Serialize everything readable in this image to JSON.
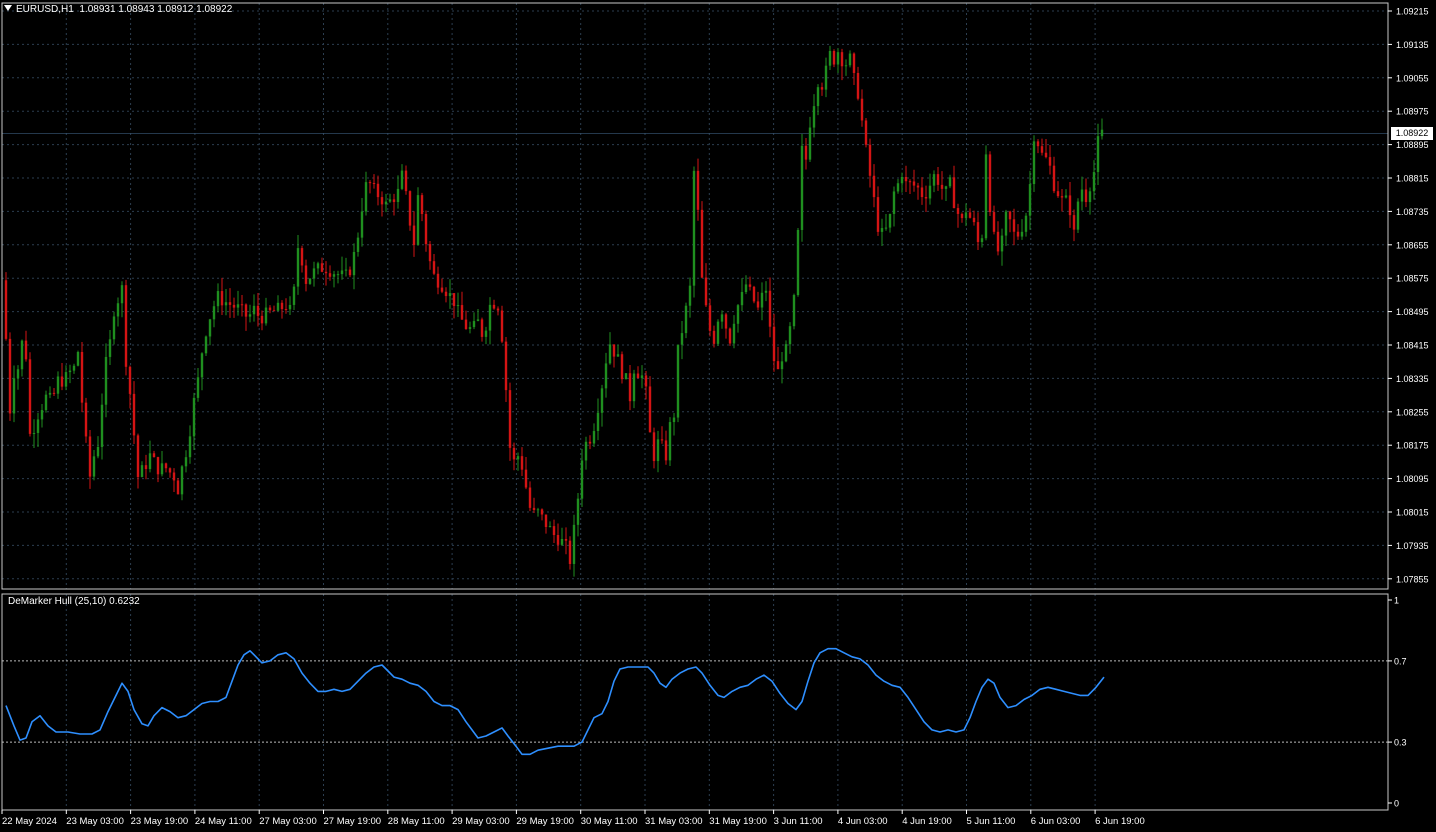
{
  "title": {
    "symbol": "EURUSD,H1",
    "ohlc": "1.08931 1.08943 1.08912 1.08922"
  },
  "price_axis": {
    "labels": [
      "1.09215",
      "1.09135",
      "1.09055",
      "1.08975",
      "1.08895",
      "1.08815",
      "1.08735",
      "1.08655",
      "1.08575",
      "1.08495",
      "1.08415",
      "1.08335",
      "1.08255",
      "1.08175",
      "1.08095",
      "1.08015",
      "1.07935",
      "1.07855"
    ],
    "current_price": "1.08922"
  },
  "indicator": {
    "title": "DeMarker Hull (25,10) 0.6232",
    "axis_labels": [
      "1",
      "0.7",
      "0.3",
      "0"
    ],
    "levels": [
      0.7,
      0.3
    ],
    "color": "#2e8fff"
  },
  "time_axis": {
    "labels": [
      "22 May 2024",
      "23 May 03:00",
      "23 May 19:00",
      "24 May 11:00",
      "27 May 03:00",
      "27 May 19:00",
      "28 May 11:00",
      "29 May 03:00",
      "29 May 19:00",
      "30 May 11:00",
      "31 May 03:00",
      "31 May 19:00",
      "3 Jun 11:00",
      "4 Jun 03:00",
      "4 Jun 19:00",
      "5 Jun 11:00",
      "6 Jun 03:00",
      "6 Jun 19:00"
    ]
  },
  "colors": {
    "background": "#000000",
    "bull": "#1f8f1f",
    "bear": "#d41414",
    "grid": "#2c3e50",
    "text": "#ffffff"
  },
  "chart_data": {
    "type": "candlestick",
    "symbol": "EURUSD",
    "timeframe": "H1",
    "y_range": [
      1.07855,
      1.09215
    ],
    "close_path": [
      [
        0,
        1.0857
      ],
      [
        4,
        1.0843
      ],
      [
        8,
        1.0826
      ],
      [
        12,
        1.0835
      ],
      [
        16,
        1.0836
      ],
      [
        20,
        1.0842
      ],
      [
        24,
        1.0839
      ],
      [
        28,
        1.082
      ],
      [
        32,
        1.0822
      ],
      [
        36,
        1.0825
      ],
      [
        44,
        1.0829
      ],
      [
        50,
        1.0828
      ],
      [
        56,
        1.0833
      ],
      [
        62,
        1.0833
      ],
      [
        68,
        1.0835
      ],
      [
        72,
        1.0836
      ],
      [
        76,
        1.084
      ],
      [
        80,
        1.0828
      ],
      [
        84,
        1.0818
      ],
      [
        88,
        1.081
      ],
      [
        92,
        1.0815
      ],
      [
        96,
        1.0818
      ],
      [
        100,
        1.0828
      ],
      [
        104,
        1.0837
      ],
      [
        108,
        1.0842
      ],
      [
        112,
        1.085
      ],
      [
        120,
        1.0855
      ],
      [
        124,
        1.0838
      ],
      [
        128,
        1.083
      ],
      [
        132,
        1.082
      ],
      [
        136,
        1.081
      ],
      [
        142,
        1.0812
      ],
      [
        148,
        1.0815
      ],
      [
        156,
        1.0812
      ],
      [
        164,
        1.0812
      ],
      [
        172,
        1.081
      ],
      [
        176,
        1.0807
      ],
      [
        180,
        1.0812
      ],
      [
        186,
        1.0818
      ],
      [
        192,
        1.0828
      ],
      [
        196,
        1.0833
      ],
      [
        200,
        1.084
      ],
      [
        204,
        1.0845
      ],
      [
        210,
        1.085
      ],
      [
        216,
        1.0853
      ],
      [
        222,
        1.0852
      ],
      [
        230,
        1.0851
      ],
      [
        238,
        1.085
      ],
      [
        246,
        1.0848
      ],
      [
        252,
        1.085
      ],
      [
        258,
        1.0848
      ],
      [
        266,
        1.0849
      ],
      [
        276,
        1.085
      ],
      [
        284,
        1.0851
      ],
      [
        290,
        1.0849
      ],
      [
        296,
        1.0865
      ],
      [
        300,
        1.0862
      ],
      [
        304,
        1.0857
      ],
      [
        308,
        1.0858
      ],
      [
        312,
        1.0859
      ],
      [
        318,
        1.086
      ],
      [
        324,
        1.086
      ],
      [
        332,
        1.0859
      ],
      [
        340,
        1.0858
      ],
      [
        346,
        1.0858
      ],
      [
        352,
        1.0863
      ],
      [
        356,
        1.0868
      ],
      [
        362,
        1.0878
      ],
      [
        366,
        1.0881
      ],
      [
        370,
        1.0879
      ],
      [
        374,
        1.0878
      ],
      [
        378,
        1.0877
      ],
      [
        382,
        1.0876
      ],
      [
        386,
        1.0874
      ],
      [
        390,
        1.0878
      ],
      [
        394,
        1.0876
      ],
      [
        400,
        1.0882
      ],
      [
        404,
        1.0877
      ],
      [
        408,
        1.0871
      ],
      [
        412,
        1.0866
      ],
      [
        416,
        1.0877
      ],
      [
        420,
        1.0873
      ],
      [
        426,
        1.0863
      ],
      [
        432,
        1.0858
      ],
      [
        440,
        1.0856
      ],
      [
        446,
        1.0854
      ],
      [
        452,
        1.0852
      ],
      [
        458,
        1.0848
      ],
      [
        464,
        1.0846
      ],
      [
        470,
        1.0845
      ],
      [
        476,
        1.0847
      ],
      [
        482,
        1.0843
      ],
      [
        486,
        1.085
      ],
      [
        490,
        1.0852
      ],
      [
        496,
        1.0851
      ],
      [
        502,
        1.084
      ],
      [
        506,
        1.0822
      ],
      [
        510,
        1.0812
      ],
      [
        514,
        1.0815
      ],
      [
        518,
        1.0815
      ],
      [
        522,
        1.081
      ],
      [
        526,
        1.0805
      ],
      [
        530,
        1.08
      ],
      [
        534,
        1.0802
      ],
      [
        540,
        1.08
      ],
      [
        546,
        1.0798
      ],
      [
        552,
        1.0796
      ],
      [
        558,
        1.0795
      ],
      [
        564,
        1.0793
      ],
      [
        568,
        1.079
      ],
      [
        572,
        1.0797
      ],
      [
        576,
        1.0805
      ],
      [
        580,
        1.0815
      ],
      [
        584,
        1.0818
      ],
      [
        590,
        1.082
      ],
      [
        596,
        1.0827
      ],
      [
        600,
        1.0832
      ],
      [
        604,
        1.0838
      ],
      [
        608,
        1.0842
      ],
      [
        612,
        1.084
      ],
      [
        616,
        1.0838
      ],
      [
        620,
        1.0835
      ],
      [
        624,
        1.0833
      ],
      [
        628,
        1.0829
      ],
      [
        632,
        1.0836
      ],
      [
        636,
        1.0835
      ],
      [
        640,
        1.0834
      ],
      [
        644,
        1.083
      ],
      [
        648,
        1.082
      ],
      [
        652,
        1.0815
      ],
      [
        656,
        1.0818
      ],
      [
        660,
        1.0817
      ],
      [
        664,
        1.0815
      ],
      [
        668,
        1.0822
      ],
      [
        672,
        1.0825
      ],
      [
        676,
        1.084
      ],
      [
        680,
        1.0845
      ],
      [
        684,
        1.085
      ],
      [
        688,
        1.0855
      ],
      [
        692,
        1.0883
      ],
      [
        696,
        1.0873
      ],
      [
        700,
        1.0857
      ],
      [
        704,
        1.085
      ],
      [
        708,
        1.0845
      ],
      [
        712,
        1.0843
      ],
      [
        716,
        1.0848
      ],
      [
        720,
        1.085
      ],
      [
        724,
        1.0846
      ],
      [
        728,
        1.0843
      ],
      [
        732,
        1.0848
      ],
      [
        736,
        1.0851
      ],
      [
        740,
        1.0853
      ],
      [
        744,
        1.0856
      ],
      [
        748,
        1.0854
      ],
      [
        752,
        1.0852
      ],
      [
        756,
        1.085
      ],
      [
        760,
        1.0853
      ],
      [
        764,
        1.0855
      ],
      [
        768,
        1.0845
      ],
      [
        772,
        1.0838
      ],
      [
        776,
        1.0835
      ],
      [
        780,
        1.0839
      ],
      [
        784,
        1.084
      ],
      [
        788,
        1.0845
      ],
      [
        792,
        1.0852
      ],
      [
        796,
        1.0868
      ],
      [
        800,
        1.0888
      ],
      [
        804,
        1.0886
      ],
      [
        808,
        1.0895
      ],
      [
        812,
        1.09
      ],
      [
        816,
        1.0905
      ],
      [
        820,
        1.0904
      ],
      [
        824,
        1.0907
      ],
      [
        828,
        1.0911
      ],
      [
        832,
        1.091
      ],
      [
        836,
        1.0912
      ],
      [
        840,
        1.091
      ],
      [
        844,
        1.0909
      ],
      [
        848,
        1.091
      ],
      [
        852,
        1.0905
      ],
      [
        856,
        1.0902
      ],
      [
        860,
        1.0895
      ],
      [
        864,
        1.0888
      ],
      [
        868,
        1.0882
      ],
      [
        872,
        1.0876
      ],
      [
        876,
        1.087
      ],
      [
        880,
        1.0868
      ],
      [
        884,
        1.0869
      ],
      [
        888,
        1.0872
      ],
      [
        892,
        1.0878
      ],
      [
        896,
        1.088
      ],
      [
        900,
        1.0883
      ],
      [
        904,
        1.088
      ],
      [
        910,
        1.088
      ],
      [
        916,
        1.0879
      ],
      [
        922,
        1.0877
      ],
      [
        928,
        1.088
      ],
      [
        932,
        1.0882
      ],
      [
        936,
        1.0881
      ],
      [
        940,
        1.0879
      ],
      [
        944,
        1.0878
      ],
      [
        948,
        1.088
      ],
      [
        952,
        1.0876
      ],
      [
        956,
        1.0873
      ],
      [
        960,
        1.0871
      ],
      [
        964,
        1.0874
      ],
      [
        968,
        1.0872
      ],
      [
        972,
        1.087
      ],
      [
        976,
        1.0866
      ],
      [
        980,
        1.0868
      ],
      [
        984,
        1.0888
      ],
      [
        988,
        1.0875
      ],
      [
        992,
        1.0867
      ],
      [
        996,
        1.0864
      ],
      [
        1000,
        1.0866
      ],
      [
        1004,
        1.0872
      ],
      [
        1008,
        1.0871
      ],
      [
        1012,
        1.0868
      ],
      [
        1016,
        1.0868
      ],
      [
        1020,
        1.087
      ],
      [
        1024,
        1.0873
      ],
      [
        1028,
        1.088
      ],
      [
        1032,
        1.0892
      ],
      [
        1036,
        1.089
      ],
      [
        1040,
        1.0887
      ],
      [
        1044,
        1.0886
      ],
      [
        1048,
        1.0884
      ],
      [
        1052,
        1.088
      ],
      [
        1056,
        1.0878
      ],
      [
        1060,
        1.0876
      ],
      [
        1064,
        1.0876
      ],
      [
        1068,
        1.0874
      ],
      [
        1072,
        1.0868
      ],
      [
        1076,
        1.0876
      ],
      [
        1080,
        1.0879
      ],
      [
        1084,
        1.0877
      ],
      [
        1088,
        1.088
      ],
      [
        1092,
        1.0883
      ],
      [
        1096,
        1.089
      ],
      [
        1100,
        1.0892
      ],
      [
        1102,
        1.0892
      ]
    ],
    "indicator_series": {
      "name": "DeMarker Hull (25,10)",
      "y_range": [
        0,
        1
      ],
      "last_value": 0.6232,
      "points": [
        [
          4,
          0.48
        ],
        [
          12,
          0.38
        ],
        [
          18,
          0.31
        ],
        [
          24,
          0.32
        ],
        [
          30,
          0.4
        ],
        [
          38,
          0.43
        ],
        [
          46,
          0.38
        ],
        [
          54,
          0.35
        ],
        [
          66,
          0.35
        ],
        [
          78,
          0.34
        ],
        [
          90,
          0.34
        ],
        [
          98,
          0.36
        ],
        [
          106,
          0.45
        ],
        [
          114,
          0.53
        ],
        [
          120,
          0.59
        ],
        [
          126,
          0.55
        ],
        [
          132,
          0.46
        ],
        [
          140,
          0.39
        ],
        [
          146,
          0.38
        ],
        [
          152,
          0.43
        ],
        [
          160,
          0.47
        ],
        [
          168,
          0.45
        ],
        [
          176,
          0.42
        ],
        [
          184,
          0.43
        ],
        [
          192,
          0.46
        ],
        [
          200,
          0.49
        ],
        [
          208,
          0.5
        ],
        [
          216,
          0.5
        ],
        [
          224,
          0.52
        ],
        [
          230,
          0.6
        ],
        [
          236,
          0.68
        ],
        [
          242,
          0.73
        ],
        [
          248,
          0.75
        ],
        [
          254,
          0.72
        ],
        [
          260,
          0.69
        ],
        [
          268,
          0.7
        ],
        [
          276,
          0.73
        ],
        [
          284,
          0.74
        ],
        [
          292,
          0.71
        ],
        [
          300,
          0.64
        ],
        [
          308,
          0.59
        ],
        [
          316,
          0.55
        ],
        [
          324,
          0.55
        ],
        [
          332,
          0.56
        ],
        [
          340,
          0.55
        ],
        [
          348,
          0.56
        ],
        [
          356,
          0.6
        ],
        [
          364,
          0.64
        ],
        [
          372,
          0.67
        ],
        [
          380,
          0.68
        ],
        [
          386,
          0.65
        ],
        [
          392,
          0.62
        ],
        [
          400,
          0.61
        ],
        [
          408,
          0.59
        ],
        [
          416,
          0.58
        ],
        [
          424,
          0.55
        ],
        [
          432,
          0.5
        ],
        [
          440,
          0.48
        ],
        [
          448,
          0.48
        ],
        [
          456,
          0.46
        ],
        [
          464,
          0.4
        ],
        [
          470,
          0.36
        ],
        [
          476,
          0.32
        ],
        [
          484,
          0.33
        ],
        [
          492,
          0.35
        ],
        [
          500,
          0.37
        ],
        [
          506,
          0.33
        ],
        [
          514,
          0.28
        ],
        [
          520,
          0.24
        ],
        [
          528,
          0.24
        ],
        [
          536,
          0.26
        ],
        [
          546,
          0.27
        ],
        [
          556,
          0.28
        ],
        [
          564,
          0.28
        ],
        [
          572,
          0.28
        ],
        [
          580,
          0.3
        ],
        [
          586,
          0.36
        ],
        [
          592,
          0.42
        ],
        [
          600,
          0.44
        ],
        [
          606,
          0.5
        ],
        [
          612,
          0.6
        ],
        [
          618,
          0.66
        ],
        [
          626,
          0.67
        ],
        [
          636,
          0.67
        ],
        [
          646,
          0.67
        ],
        [
          652,
          0.64
        ],
        [
          658,
          0.59
        ],
        [
          664,
          0.57
        ],
        [
          670,
          0.61
        ],
        [
          678,
          0.64
        ],
        [
          686,
          0.66
        ],
        [
          694,
          0.67
        ],
        [
          700,
          0.64
        ],
        [
          708,
          0.58
        ],
        [
          716,
          0.53
        ],
        [
          722,
          0.52
        ],
        [
          730,
          0.55
        ],
        [
          738,
          0.57
        ],
        [
          746,
          0.58
        ],
        [
          754,
          0.61
        ],
        [
          762,
          0.63
        ],
        [
          770,
          0.6
        ],
        [
          778,
          0.54
        ],
        [
          786,
          0.49
        ],
        [
          794,
          0.46
        ],
        [
          800,
          0.5
        ],
        [
          806,
          0.6
        ],
        [
          812,
          0.69
        ],
        [
          818,
          0.74
        ],
        [
          826,
          0.76
        ],
        [
          834,
          0.76
        ],
        [
          842,
          0.74
        ],
        [
          850,
          0.72
        ],
        [
          858,
          0.71
        ],
        [
          866,
          0.68
        ],
        [
          874,
          0.63
        ],
        [
          882,
          0.6
        ],
        [
          890,
          0.58
        ],
        [
          898,
          0.57
        ],
        [
          906,
          0.52
        ],
        [
          914,
          0.46
        ],
        [
          922,
          0.4
        ],
        [
          930,
          0.36
        ],
        [
          938,
          0.35
        ],
        [
          946,
          0.36
        ],
        [
          954,
          0.35
        ],
        [
          962,
          0.36
        ],
        [
          968,
          0.42
        ],
        [
          974,
          0.5
        ],
        [
          980,
          0.57
        ],
        [
          986,
          0.61
        ],
        [
          992,
          0.59
        ],
        [
          998,
          0.52
        ],
        [
          1006,
          0.47
        ],
        [
          1014,
          0.48
        ],
        [
          1022,
          0.51
        ],
        [
          1030,
          0.53
        ],
        [
          1038,
          0.56
        ],
        [
          1046,
          0.57
        ],
        [
          1054,
          0.56
        ],
        [
          1062,
          0.55
        ],
        [
          1070,
          0.54
        ],
        [
          1078,
          0.53
        ],
        [
          1086,
          0.53
        ],
        [
          1094,
          0.57
        ],
        [
          1102,
          0.62
        ]
      ]
    }
  }
}
